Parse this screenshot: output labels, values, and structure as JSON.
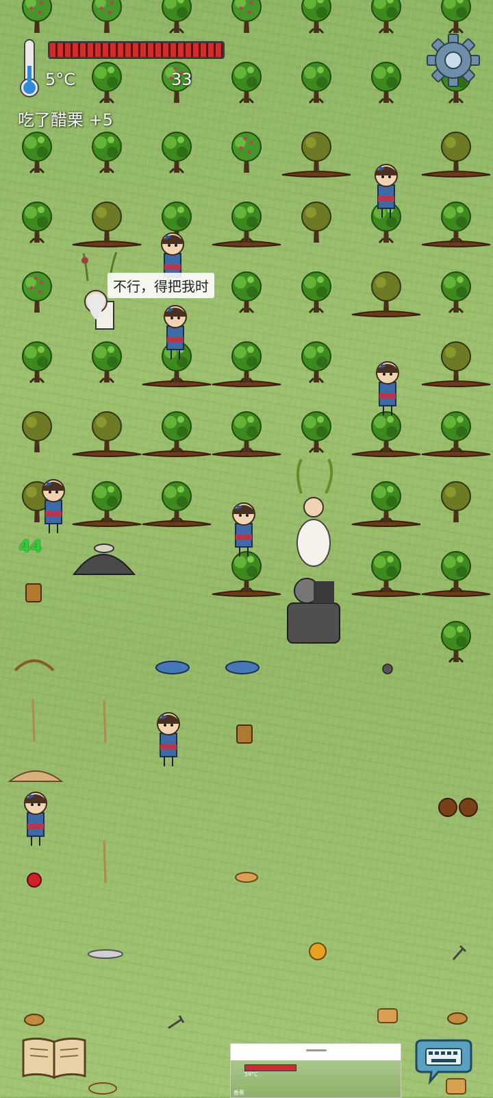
{
  "hud": {
    "temperature": "5°C",
    "yum_count": "33",
    "status": "吃了醋栗 +5",
    "food_level": 1.0
  },
  "speech": {
    "text": "不行，得把我时"
  },
  "age_label": "44",
  "mini_preview": {
    "temperature": "59°C",
    "status": "香蕉"
  },
  "colors": {
    "food_bar": "#d42b2b",
    "age_label": "#25d63a",
    "grass": "#9cc06e"
  },
  "icons": {
    "settings": "gear-icon",
    "thermometer": "thermometer-icon",
    "recipe_book": "book-icon",
    "keyboard": "keyboard-icon"
  }
}
